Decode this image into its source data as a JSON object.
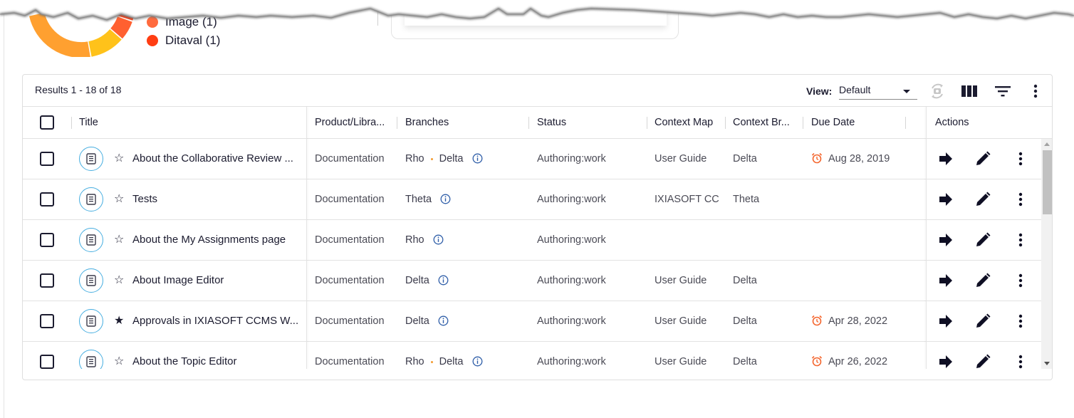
{
  "summary": {
    "legend": [
      {
        "label": "Image (1)",
        "color": "#ff6a3d"
      },
      {
        "label": "Ditaval (1)",
        "color": "#ff3d12"
      }
    ],
    "donut_colors": [
      "#ffa030",
      "#ffc21a",
      "#ff6030",
      "#ff3d12"
    ]
  },
  "toolbar": {
    "results": "Results 1 - 18 of 18",
    "view_label": "View:",
    "view_value": "Default",
    "icons": [
      "refresh-icon",
      "columns-icon",
      "filter-icon",
      "more-vert-icon"
    ]
  },
  "columns": {
    "title": "Title",
    "product": "Product/Libra...",
    "branches": "Branches",
    "status": "Status",
    "context_map": "Context Map",
    "context_branch": "Context Br...",
    "due_date": "Due Date",
    "actions": "Actions"
  },
  "rows": [
    {
      "title": "About the Collaborative Review ...",
      "starred": "☆",
      "product": "Documentation",
      "branch1": "Rho",
      "branch2": "Delta",
      "status": "Authoring:work",
      "context_map": "User Guide",
      "context_branch": "Delta",
      "due_date": "Aug 28, 2019"
    },
    {
      "title": "Tests",
      "starred": "☆",
      "product": "Documentation",
      "branch1": "Theta",
      "branch2": "",
      "status": "Authoring:work",
      "context_map": "IXIASOFT CC",
      "context_branch": "Theta",
      "due_date": ""
    },
    {
      "title": "About the My Assignments page",
      "starred": "☆",
      "product": "Documentation",
      "branch1": "Rho",
      "branch2": "",
      "status": "Authoring:work",
      "context_map": "",
      "context_branch": "",
      "due_date": ""
    },
    {
      "title": "About Image Editor",
      "starred": "☆",
      "product": "Documentation",
      "branch1": "Delta",
      "branch2": "",
      "status": "Authoring:work",
      "context_map": "User Guide",
      "context_branch": "Delta",
      "due_date": ""
    },
    {
      "title": "Approvals in IXIASOFT CCMS W...",
      "starred": "★",
      "product": "Documentation",
      "branch1": "Delta",
      "branch2": "",
      "status": "Authoring:work",
      "context_map": "User Guide",
      "context_branch": "Delta",
      "due_date": "Apr 28, 2022"
    },
    {
      "title": "About the Topic Editor",
      "starred": "☆",
      "product": "Documentation",
      "branch1": "Rho",
      "branch2": "Delta",
      "status": "Authoring:work",
      "context_map": "User Guide",
      "context_branch": "Delta",
      "due_date": "Apr 26, 2022"
    }
  ],
  "colors": {
    "accent_orange": "#f4662e",
    "doc_icon_ring": "#47aee0",
    "info_icon": "#2f5ea8",
    "text_dark": "#1b1b2f"
  }
}
